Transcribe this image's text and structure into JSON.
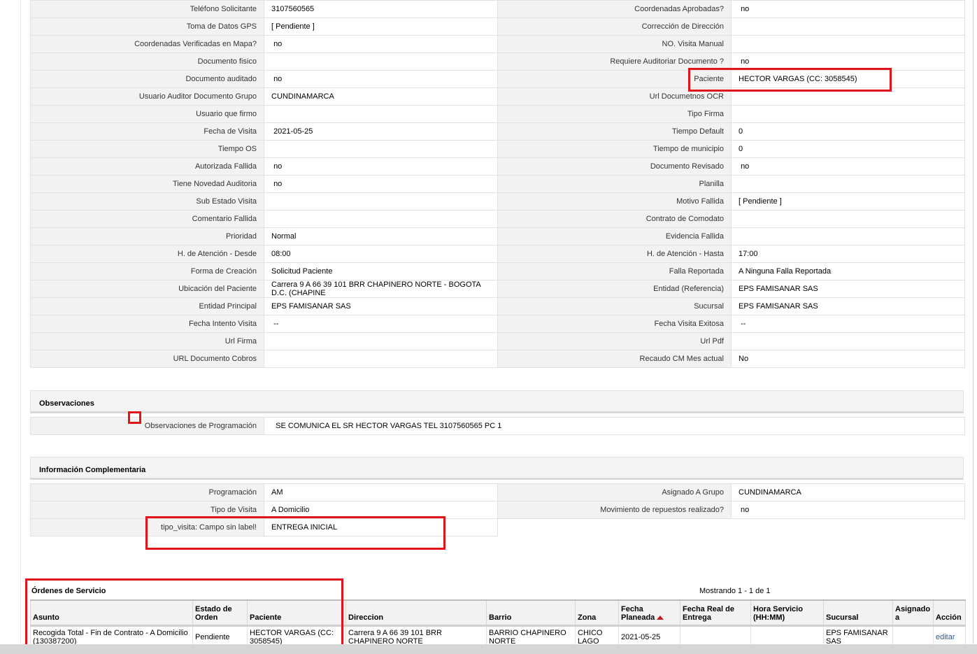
{
  "detail_rows": [
    {
      "l1": "Teléfono Solicitante",
      "v1": "3107560565",
      "l2": "Coordenadas Aprobadas?",
      "v2": " no"
    },
    {
      "l1": "Toma de Datos GPS",
      "v1": "[ Pendiente ]",
      "l2": "Corrección de Dirección",
      "v2": ""
    },
    {
      "l1": "Coordenadas Verificadas en Mapa?",
      "v1": " no",
      "l2": "NO. Visita Manual",
      "v2": ""
    },
    {
      "l1": "Documento fisico",
      "v1": "",
      "l2": "Requiere Auditoriar Documento ?",
      "v2": " no"
    },
    {
      "l1": "Documento auditado",
      "v1": " no",
      "l2": "Paciente",
      "v2": "HECTOR VARGAS (CC: 3058545)"
    },
    {
      "l1": "Usuario Auditor Documento Grupo",
      "v1": "CUNDINAMARCA",
      "l2": "Url Documetnos OCR",
      "v2": ""
    },
    {
      "l1": "Usuario que firmo",
      "v1": "",
      "l2": "Tipo Firma",
      "v2": ""
    },
    {
      "l1": "Fecha de Visita",
      "v1": " 2021-05-25",
      "l2": "Tiempo Default",
      "v2": "0"
    },
    {
      "l1": "Tiempo OS",
      "v1": "",
      "l2": "Tiempo de municipio",
      "v2": "0"
    },
    {
      "l1": "Autorizada Fallida",
      "v1": " no",
      "l2": "Documento Revisado",
      "v2": " no"
    },
    {
      "l1": "Tiene Novedad Auditoria",
      "v1": " no",
      "l2": "Planilla",
      "v2": ""
    },
    {
      "l1": "Sub Estado Visita",
      "v1": "",
      "l2": "Motivo Fallida",
      "v2": "[ Pendiente ]"
    },
    {
      "l1": "Comentario Fallida",
      "v1": "",
      "l2": "Contrato de Comodato",
      "v2": ""
    },
    {
      "l1": "Prioridad",
      "v1": "Normal",
      "l2": "Evidencia Fallida",
      "v2": ""
    },
    {
      "l1": "H. de Atención - Desde",
      "v1": "08:00",
      "l2": "H. de Atención - Hasta",
      "v2": "17:00"
    },
    {
      "l1": "Forma de Creación",
      "v1": "Solicitud Paciente",
      "l2": "Falla Reportada",
      "v2": "A Ninguna Falla Reportada"
    },
    {
      "l1": "Ubicación del Paciente",
      "v1": "Carrera 9 A 66 39 101 BRR CHAPINERO NORTE - BOGOTA D.C. (CHAPINE",
      "l2": "Entidad (Referencia)",
      "v2": "EPS FAMISANAR SAS"
    },
    {
      "l1": "Entidad Principal",
      "v1": "EPS FAMISANAR SAS",
      "l2": "Sucursal",
      "v2": "EPS FAMISANAR SAS"
    },
    {
      "l1": "Fecha Intento Visita",
      "v1": " --",
      "l2": "Fecha Visita Exitosa",
      "v2": " --"
    },
    {
      "l1": "Url Firma",
      "v1": "",
      "l2": "Url Pdf",
      "v2": ""
    },
    {
      "l1": "URL Documento Cobros",
      "v1": "",
      "l2": "Recaudo CM Mes actual",
      "v2": "No"
    }
  ],
  "observaciones": {
    "title": "Observaciones",
    "label": "Observaciones de Programación",
    "value": "  SE COMUNICA EL SR HECTOR VARGAS TEL 3107560565 PC 1"
  },
  "info": {
    "title": "Información Complementaria",
    "rows": [
      {
        "l1": "Programación",
        "v1": "AM",
        "l2": "Asignado A Grupo",
        "v2": "CUNDINAMARCA"
      },
      {
        "l1": "Tipo de Visita",
        "v1": "A Domicilio",
        "l2": "Movimiento de repuestos realizado?",
        "v2": " no"
      }
    ],
    "extra_label": "tipo_visita: Campo sin label!",
    "extra_value": "ENTREGA INICIAL"
  },
  "orders": {
    "title": "Órdenes de Servicio",
    "showing": "Mostrando 1 - 1 de 1",
    "headers": [
      "Asunto",
      "Estado de Orden",
      "Paciente",
      "Direccion",
      "Barrio",
      "Zona",
      "Fecha Planeada",
      "Fecha Real de Entrega",
      "Hora Servicio (HH:MM)",
      "Sucursal",
      "Asignado a",
      "Acción"
    ],
    "row": {
      "asunto": "Recogida Total - Fin de Contrato - A Domicilio (130387200)",
      "estado": "Pendiente",
      "paciente": "HECTOR VARGAS (CC: 3058545)",
      "direccion": "Carrera 9 A 66 39 101 BRR CHAPINERO NORTE",
      "barrio": "BARRIO CHAPINERO NORTE",
      "zona": "CHICO LAGO",
      "fecha_planeada": "2021-05-25",
      "fecha_real": "",
      "hora": "",
      "sucursal": "EPS FAMISANAR SAS",
      "asignado": "",
      "accion": "editar"
    }
  },
  "colors": {
    "highlight": "#e0141b",
    "label_bg": "#f2f2f2",
    "link": "#2d5b8f"
  }
}
